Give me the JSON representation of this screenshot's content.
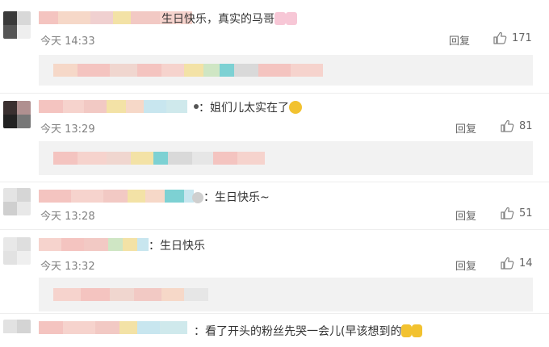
{
  "comments": [
    {
      "text": "生日快乐，真实的马哥",
      "time": "今天 14:33",
      "reply": "回复",
      "likes": "171"
    },
    {
      "text": "姐们儿太实在了",
      "time": "今天 13:29",
      "reply": "回复",
      "likes": "81"
    },
    {
      "text": "：生日快乐~",
      "time": "今天 13:28",
      "reply": "回复",
      "likes": "51"
    },
    {
      "text": "：生日快乐",
      "time": "今天 13:32",
      "reply": "回复",
      "likes": "14"
    },
    {
      "text": "：看了开头的粉丝先哭一会儿(早该想到的",
      "time": "",
      "reply": "",
      "likes": ""
    }
  ],
  "colors": {
    "pink": "#f4c4c0",
    "peach": "#f6d8c8",
    "yellow": "#f3e2a6",
    "green": "#cfe6c4",
    "teal": "#7dd1d3",
    "lightblue": "#c8e6ef",
    "grey": "#d9d9d9"
  },
  "icons": [
    "thumb-up-icon",
    "emoji-icon",
    "cake-emoji-icon",
    "cry-laugh-emoji-icon"
  ]
}
